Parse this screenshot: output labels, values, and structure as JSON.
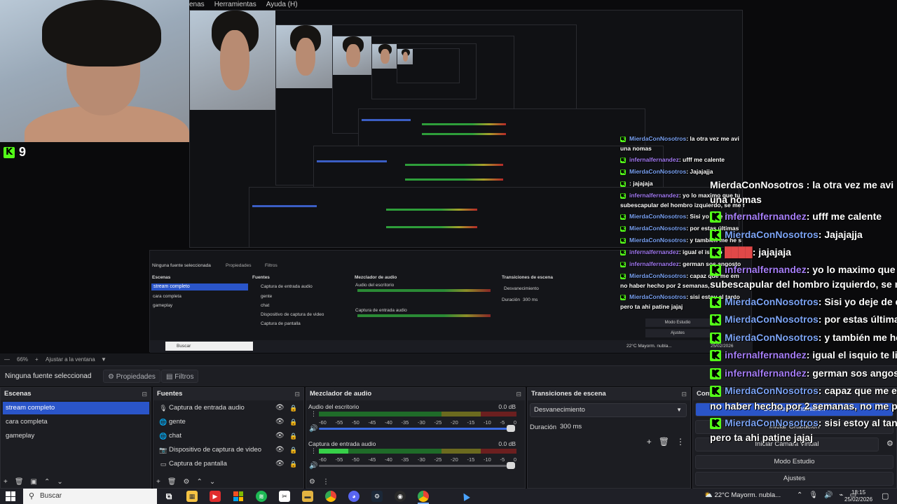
{
  "menubar": {
    "items": [
      "enas",
      "Herramientas",
      "Ayuda (H)"
    ]
  },
  "kick": {
    "viewer_count": "9"
  },
  "inner_obs": {
    "no_source": "Ninguna fuente seleccionada",
    "properties": "Propiedades",
    "filters": "Filtros",
    "scenes_title": "Escenas",
    "sources_title": "Fuentes",
    "mixer_title": "Mezclador de audio",
    "transitions_title": "Transiciones de escena",
    "scenes": [
      "stream completo",
      "cara completa",
      "gameplay"
    ],
    "sources": [
      "Captura de entrada audio",
      "gente",
      "chat",
      "Dispositivo de captura de video",
      "Captura de pantalla"
    ],
    "desktop_audio": "Audio del escritorio",
    "mic_audio": "Captura de entrada audio",
    "transition": "Desvanecimiento",
    "duration_label": "Duración",
    "duration": "300 ms",
    "studio": "Modo Estudio",
    "settings": "Ajustes",
    "search": "Buscar",
    "weather": "22°C  Mayorm. nubla...",
    "date": "25/02/2026"
  },
  "chat": {
    "small": [
      {
        "user": "MierdaConNosotros",
        "msg": ": la otra vez me avi"
      },
      {
        "user": "",
        "msg": "una nomas"
      },
      {
        "user": "infernalfernandez",
        "msg": ": ufff me calente"
      },
      {
        "user": "MierdaConNosotros",
        "msg": ": Jajajajja"
      },
      {
        "user": "",
        "msg": ": jajajaja"
      },
      {
        "user": "infernalfernandez",
        "msg": ": yo lo maximo que tu"
      },
      {
        "user": "",
        "msg": "subescapular del hombro izquierdo, se me f"
      },
      {
        "user": "MierdaConNosotros",
        "msg": ": Sisi yo deje de ent"
      },
      {
        "user": "MierdaConNosotros",
        "msg": ": por estas últimas"
      },
      {
        "user": "MierdaConNosotros",
        "msg": ": y tambien me he s"
      },
      {
        "user": "infernalfernandez",
        "msg": ": igual el isquio te limi"
      },
      {
        "user": "infernalfernandez",
        "msg": ": german sos angosto"
      },
      {
        "user": "MierdaConNosotros",
        "msg": ": capaz que me em"
      },
      {
        "user": "",
        "msg": "no haber hecho por 2 semanas,"
      },
      {
        "user": "MierdaConNosotros",
        "msg": ": sisi estoy al tanto"
      },
      {
        "user": "",
        "msg": "pero ta ahi patine jajaj"
      }
    ],
    "big": [
      {
        "user": "",
        "msg": "MierdaConNosotros : la otra vez me avi"
      },
      {
        "user": "",
        "msg": "una nomas"
      },
      {
        "user": "infernalfernandez",
        "msg": ": ufff me calente"
      },
      {
        "user": "MierdaConNosotros",
        "msg": ": Jajajajja"
      },
      {
        "user": "",
        "msg": ": jajajaja"
      },
      {
        "user": "infernalfernandez",
        "msg": ": yo lo maximo que tu"
      },
      {
        "user": "",
        "msg": "subescapular del hombro izquierdo, se me f"
      },
      {
        "user": "MierdaConNosotros",
        "msg": ": Sisi yo deje de ent"
      },
      {
        "user": "MierdaConNosotros",
        "msg": ": por estas últimas"
      },
      {
        "user": "MierdaConNosotros",
        "msg": ": y también me he s"
      },
      {
        "user": "infernalfernandez",
        "msg": ": igual el isquio te limi"
      },
      {
        "user": "infernalfernandez",
        "msg": ": german sos angosto"
      },
      {
        "user": "MierdaConNosotros",
        "msg": ": capaz que me em"
      },
      {
        "user": "",
        "msg": "no haber hecho por 2 semanas, no me pare"
      },
      {
        "user": "MierdaConNosotros",
        "msg": ": sisi estoy al tanto"
      },
      {
        "user": "",
        "msg": "pero ta ahi patine jajaj"
      }
    ]
  },
  "status": {
    "zoom": "66%",
    "fit": "Ajustar a la ventana"
  },
  "props": {
    "no_source": "Ninguna fuente seleccionad",
    "properties": "Propiedades",
    "filters": "Filtros"
  },
  "scenes": {
    "title": "Escenas",
    "items": [
      "stream completo",
      "cara completa",
      "gameplay"
    ]
  },
  "sources": {
    "title": "Fuentes",
    "items": [
      {
        "label": "Captura de entrada audio",
        "icon": "microphone-icon"
      },
      {
        "label": "gente",
        "icon": "globe-icon"
      },
      {
        "label": "chat",
        "icon": "globe-icon"
      },
      {
        "label": "Dispositivo de captura de video",
        "icon": "camera-icon"
      },
      {
        "label": "Captura de pantalla",
        "icon": "monitor-icon"
      }
    ]
  },
  "mixer": {
    "title": "Mezclador de audio",
    "channels": [
      {
        "name": "Audio del escritorio",
        "db": "0.0 dB",
        "level": 0.0
      },
      {
        "name": "Captura de entrada audio",
        "db": "0.0 dB",
        "level": 0.15
      }
    ],
    "ticks": [
      "-60",
      "-55",
      "-50",
      "-45",
      "-40",
      "-35",
      "-30",
      "-25",
      "-20",
      "-15",
      "-10",
      "-5",
      "0"
    ]
  },
  "transitions": {
    "title": "Transiciones de escena",
    "selected": "Desvanecimiento",
    "duration_label": "Duración",
    "duration": "300 ms"
  },
  "controls": {
    "title": "Cont",
    "buttons": [
      "Detener Transmisión",
      "Iniciar Grabación",
      "Iniciar Cámara Virtual",
      "Modo Estudio",
      "Ajustes"
    ]
  },
  "taskbar": {
    "search_placeholder": "Buscar",
    "weather": "22°C  Mayorm. nubla...",
    "time": "18:15",
    "date": "25/02/2026"
  },
  "colors": {
    "accent": "#2a55c9",
    "kick_green": "#53fc18",
    "user_c": "#7ca4f5",
    "user_i": "#a67ef7"
  }
}
